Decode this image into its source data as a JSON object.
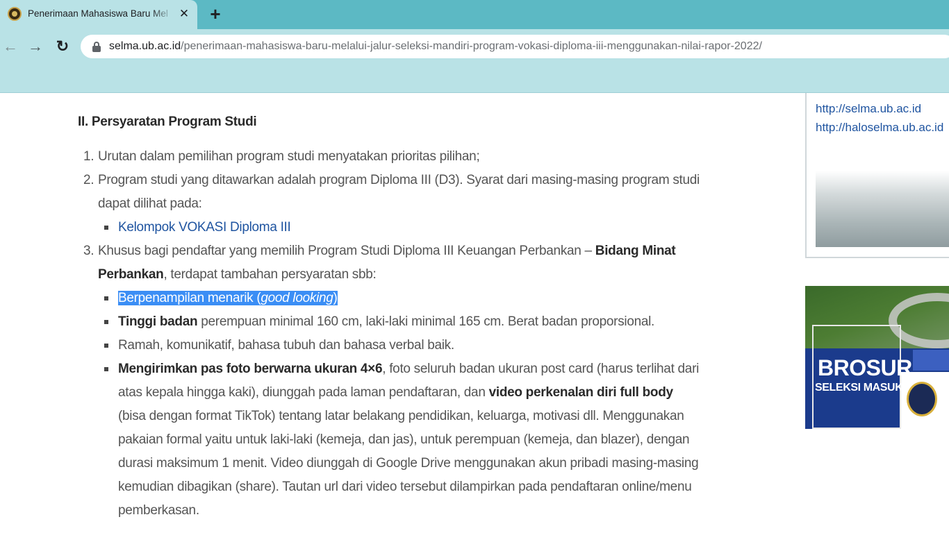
{
  "browser": {
    "tab_title": "Penerimaan Mahasiswa Baru Mel",
    "tab_close": "✕",
    "new_tab": "+",
    "url_host": "selma.ub.ac.id",
    "url_path": "/penerimaan-mahasiswa-baru-melalui-jalur-seleksi-mandiri-program-vokasi-diploma-iii-menggunakan-nilai-rapor-2022/",
    "icons": {
      "back": "←",
      "forward": "→",
      "reload": "↻"
    }
  },
  "article": {
    "heading": "II. Persyaratan Program Studi",
    "items": [
      {
        "num": "1.",
        "text": "Urutan dalam pemilihan program studi menyatakan prioritas pilihan;"
      },
      {
        "num": "2.",
        "text": "Program studi yang ditawarkan adalah program Diploma III (D3). Syarat dari masing-masing program studi dapat dilihat pada:"
      },
      {
        "num": "3.",
        "text_before": "Khusus bagi pendaftar yang memilih Program Studi Diploma III Keuangan Perbankan – ",
        "bold": "Bidang Minat Perbankan",
        "text_after": ", terdapat tambahan persyaratan sbb:"
      }
    ],
    "item2_link": "Kelompok VOKASI Diploma III",
    "item3_bullets": {
      "b1_text": "Berpenampilan menarik (",
      "b1_italic": "good looking",
      "b1_close": ")",
      "b2_bold": "Tinggi badan",
      "b2_text": " perempuan minimal 160 cm, laki-laki minimal 165 cm. Berat badan proporsional.",
      "b3_text": "Ramah, komunikatif, bahasa tubuh dan bahasa verbal baik.",
      "b4_bold1": "Mengirimkan pas foto berwarna ukuran 4×6",
      "b4_text1": ", foto seluruh badan ukuran post card (harus terlihat dari atas kepala hingga kaki), diunggah pada laman pendaftaran, dan ",
      "b4_bold2": "video perkenalan diri full body",
      "b4_text2": " (bisa dengan format TikTok) tentang latar belakang pendidikan, keluarga, motivasi dll. Menggunakan pakaian formal yaitu untuk laki-laki (kemeja, dan jas), untuk perempuan (kemeja, dan blazer), dengan durasi maksimum 1 menit. Video diunggah di Google Drive menggunakan akun pribadi masing-masing kemudian dibagikan (share). Tautan url dari video tersebut dilampirkan pada pendaftaran online/menu pemberkasan."
    }
  },
  "sidebar": {
    "link1": "http://selma.ub.ac.id",
    "link2": "http://haloselma.ub.ac.id",
    "brochure_title": "BROSUR",
    "brochure_subtitle": "SELEKSI MASUK"
  },
  "colors": {
    "tab_strip": "#5cb9c4",
    "toolbar": "#b9e2e6",
    "link": "#1f54a0",
    "selection": "#3b8ef5"
  }
}
